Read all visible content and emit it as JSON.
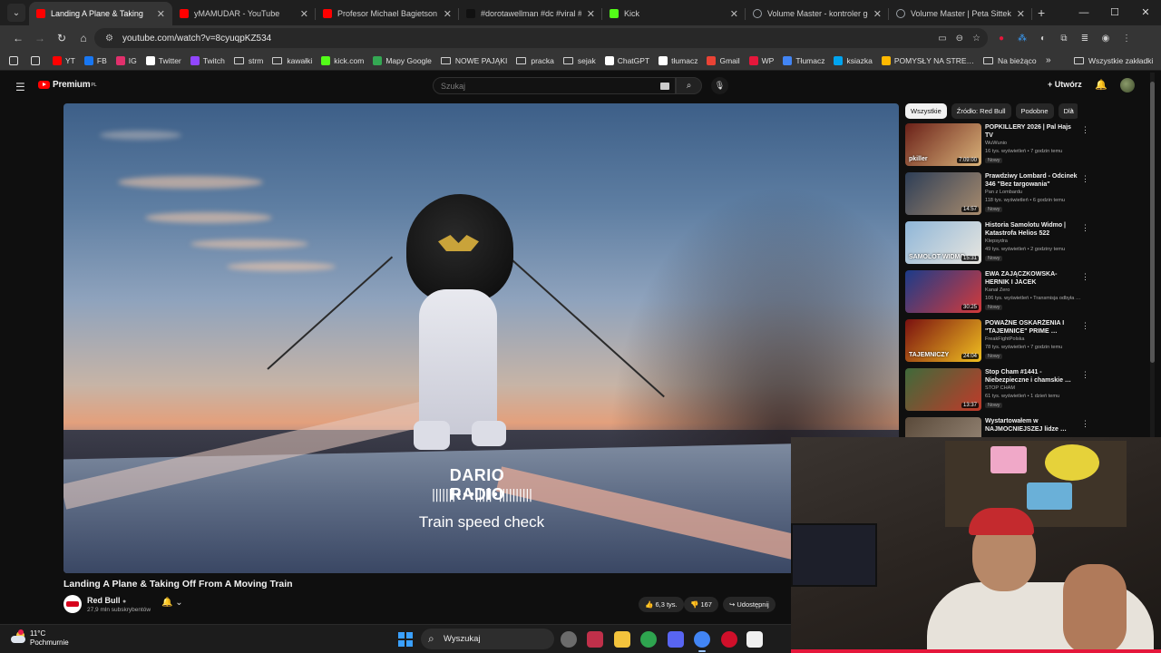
{
  "browser": {
    "tabs": [
      {
        "label": "Landing A Plane & Taking",
        "active": true,
        "icon": "youtube-icon",
        "color": "#ff0000"
      },
      {
        "label": "yMAMUDAR - YouTube",
        "active": false,
        "icon": "youtube-icon",
        "color": "#ff0000"
      },
      {
        "label": "Profesor Michael Bagietson - …",
        "active": false,
        "icon": "youtube-icon",
        "color": "#ff0000"
      },
      {
        "label": "#dorotawellman #dc #viral #d",
        "active": false,
        "icon": "tiktok-icon",
        "color": "#111111"
      },
      {
        "label": "Kick",
        "active": false,
        "icon": "kick-icon",
        "color": "#53fc18"
      },
      {
        "label": "Volume Master - kontroler głoś",
        "active": false,
        "icon": "globe-icon",
        "color": "#9aa0a6"
      },
      {
        "label": "Volume Master | Peta Sittek",
        "active": false,
        "icon": "globe-icon",
        "color": "#9aa0a6"
      }
    ],
    "url": "youtube.com/watch?v=8cyuqpKZ534",
    "bookmarks": [
      {
        "label": "",
        "icon": "bookmark-page-icon",
        "color": "#e0e0e0"
      },
      {
        "label": "",
        "icon": "apps-grid-icon",
        "color": "#e0e0e0"
      },
      {
        "label": "YT",
        "icon": "youtube-icon",
        "color": "#ff0000"
      },
      {
        "label": "FB",
        "icon": "facebook-icon",
        "color": "#1877f2"
      },
      {
        "label": "IG",
        "icon": "instagram-icon",
        "color": "#e1306c"
      },
      {
        "label": "Twitter",
        "icon": "x-icon",
        "color": "#ffffff"
      },
      {
        "label": "Twitch",
        "icon": "twitch-icon",
        "color": "#9146ff"
      },
      {
        "label": "strm",
        "icon": "folder-icon",
        "color": ""
      },
      {
        "label": "kawałki",
        "icon": "folder-icon",
        "color": ""
      },
      {
        "label": "kick.com",
        "icon": "kick-icon",
        "color": "#53fc18"
      },
      {
        "label": "Mapy Google",
        "icon": "maps-pin-icon",
        "color": "#34a853"
      },
      {
        "label": "NOWE PAJĄKI",
        "icon": "folder-icon",
        "color": ""
      },
      {
        "label": "pracka",
        "icon": "folder-icon",
        "color": ""
      },
      {
        "label": "sejak",
        "icon": "folder-icon",
        "color": ""
      },
      {
        "label": "ChatGPT",
        "icon": "chatgpt-icon",
        "color": "#ffffff"
      },
      {
        "label": "tłumacz",
        "icon": "gear-icon",
        "color": "#ffffff"
      },
      {
        "label": "Gmail",
        "icon": "gmail-icon",
        "color": "#ea4335"
      },
      {
        "label": "WP",
        "icon": "wp-icon",
        "color": "#e5173b"
      },
      {
        "label": "Tłumacz",
        "icon": "translate-icon",
        "color": "#4285f4"
      },
      {
        "label": "ksiazka",
        "icon": "windows-color-icon",
        "color": "#00a4ef"
      },
      {
        "label": "POMYSŁY NA STRE…",
        "icon": "windows-color-icon",
        "color": "#ffb900"
      },
      {
        "label": "Na bieżąco",
        "icon": "folder-icon",
        "color": ""
      }
    ],
    "all_bookmarks": "Wszystkie zakładki"
  },
  "youtube": {
    "logo_text": "Premium",
    "region": "PL",
    "search_placeholder": "Szukaj",
    "create_label": "Utwórz",
    "video": {
      "title": "Landing A Plane & Taking Off From A Moving Train",
      "channel": "Red Bull",
      "subscribers": "27,9 mln subskrybentów",
      "likes": "6,3 tys.",
      "dislikes": "167",
      "share": "Udostępnij",
      "overlay_title": "DARIO RADIO",
      "overlay_wave": "|||||||•••|||||•||||||||||",
      "overlay_subtitle": "Train speed check"
    },
    "chips": [
      {
        "label": "Wszystkie",
        "active": true
      },
      {
        "label": "Źródło: Red Bull",
        "active": false
      },
      {
        "label": "Podobne",
        "active": false
      },
      {
        "label": "Dla",
        "active": false
      }
    ],
    "recommendations": [
      {
        "title": "POPKILLERY 2026 | Pal Hajs TV",
        "channel": "WuWunio",
        "meta": "16 tys. wyświetleń • 7 godzin temu",
        "badge": "Nowy",
        "duration": "7:09:00",
        "thumb_text": "pkiller",
        "colors": [
          "#6a2018",
          "#d9b37a"
        ]
      },
      {
        "title": "Prawdziwy Lombard - Odcinek 346 \"Bez targowania\"",
        "channel": "Pan z Lombardu",
        "meta": "118 tys. wyświetleń • 6 godzin temu",
        "badge": "Nowy",
        "duration": "14:57",
        "thumb_text": "",
        "colors": [
          "#2d3e57",
          "#a88b6d"
        ]
      },
      {
        "title": "Historia Samolotu Widmo | Katastrofa Helios 522",
        "channel": "Klepsydra",
        "meta": "49 tys. wyświetleń • 2 godziny temu",
        "badge": "Nowy",
        "duration": "15:31",
        "thumb_text": "SAMOLOT WIDMO",
        "colors": [
          "#8fb6d8",
          "#e8e6df"
        ]
      },
      {
        "title": "EWA ZAJĄCZKOWSKA-HERNIK I JACEK PRUSINOWSKI - …",
        "channel": "Kanał Zero",
        "meta": "106 tys. wyświetleń • Transmisja odbyła …",
        "badge": "Nowy",
        "duration": "30:25",
        "thumb_text": "",
        "colors": [
          "#1b3b8a",
          "#d43a3a"
        ]
      },
      {
        "title": "POWAŻNE OSKARŻENIA I \"TAJEMNICE\" PRIME …",
        "channel": "FreakFightPolska",
        "meta": "78 tys. wyświetleń • 7 godzin temu",
        "badge": "Nowy",
        "duration": "24:04",
        "thumb_text": "TAJEMNICZY",
        "colors": [
          "#7a1010",
          "#f0c020"
        ]
      },
      {
        "title": "Stop Cham #1441 - Niebezpieczne i chamskie …",
        "channel": "STOP CHAM",
        "meta": "61 tys. wyświetleń • 1 dzień temu",
        "badge": "Nowy",
        "duration": "13:37",
        "thumb_text": "",
        "colors": [
          "#3f6a3a",
          "#c03a2a"
        ]
      },
      {
        "title": "Wystartowałem w NAJMOCNIEJSZEJ lidze …",
        "channel": "",
        "meta": "",
        "badge": "",
        "duration": "",
        "thumb_text": "",
        "colors": [
          "#5a4a3a",
          "#9a8a7a"
        ]
      }
    ]
  },
  "taskbar": {
    "temperature": "11°C",
    "weather": "Pochmurnie",
    "search_label": "Wyszukaj",
    "apps": [
      {
        "name": "copilot-icon",
        "color": "#6b6b6b"
      },
      {
        "name": "photos-icon",
        "color": "#c0304a"
      },
      {
        "name": "file-explorer-icon",
        "color": "#f3c33c"
      },
      {
        "name": "norton-icon",
        "color": "#2ea44f"
      },
      {
        "name": "discord-icon",
        "color": "#5865f2"
      },
      {
        "name": "chrome-icon",
        "color": "#4285f4"
      },
      {
        "name": "opera-icon",
        "color": "#d00f2a"
      },
      {
        "name": "streamlabs-icon",
        "color": "#f0f0f0"
      }
    ]
  }
}
